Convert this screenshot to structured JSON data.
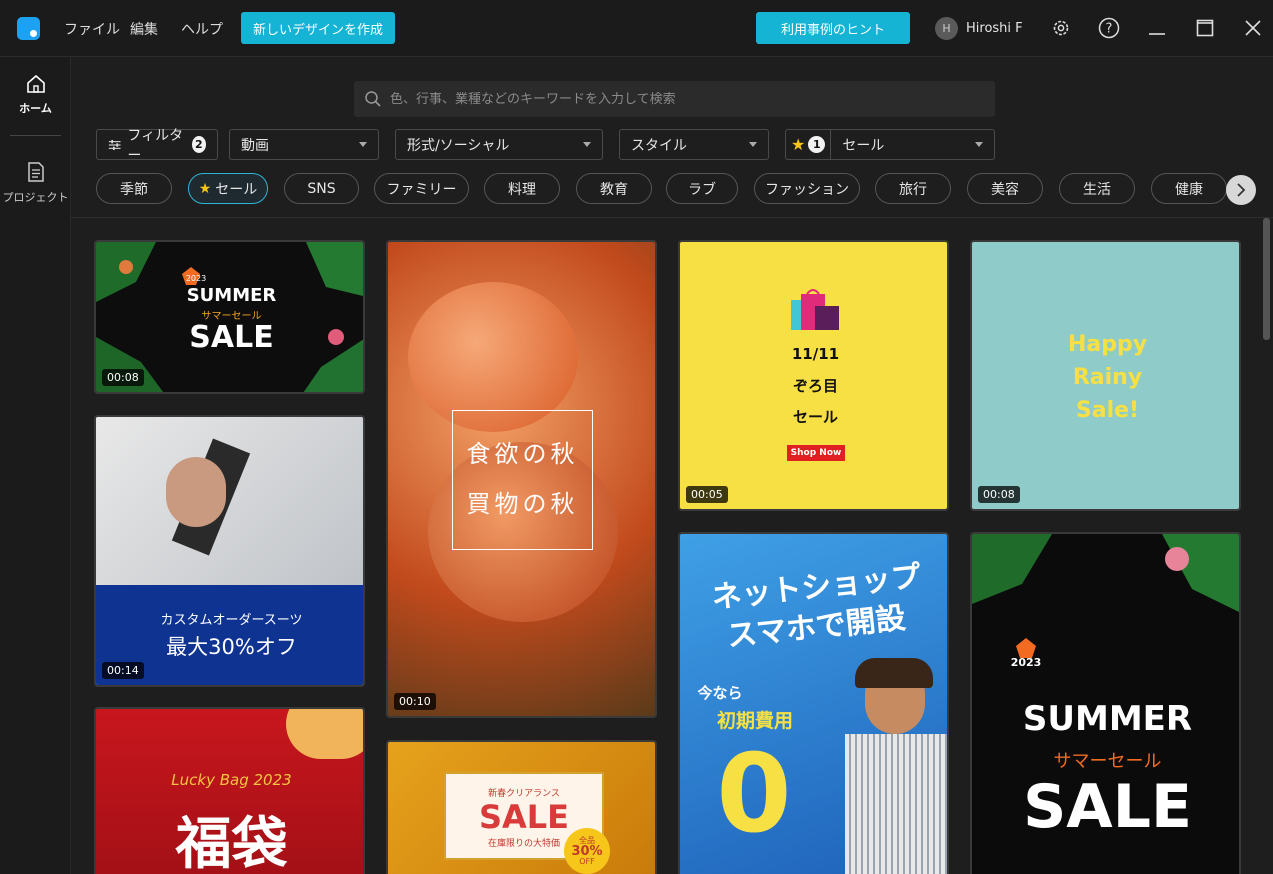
{
  "titlebar": {
    "menu": [
      "ファイル",
      "編集",
      "ヘルプ"
    ],
    "create_button": "新しいデザインを作成",
    "hint_button": "利用事例のヒント",
    "user_initial": "H",
    "user_name": "Hiroshi F"
  },
  "sidebar": {
    "home_label": "ホーム",
    "projects_label": "プロジェクト"
  },
  "search": {
    "placeholder": "色、行事、業種などのキーワードを入力して検索"
  },
  "filters": {
    "filter_label": "フィルター",
    "filter_count": "2",
    "type_value": "動画",
    "format_value": "形式/ソーシャル",
    "style_value": "スタイル",
    "fav_count": "1",
    "category_value": "セール"
  },
  "tags": [
    "季節",
    "セール",
    "SNS",
    "ファミリー",
    "料理",
    "教育",
    "ラブ",
    "ファッション",
    "旅行",
    "美容",
    "生活",
    "健康"
  ],
  "selected_tag": "セール",
  "cards": {
    "summer1": {
      "line1": "2023",
      "line2": "SUMMER",
      "line3": "サマーセール",
      "line4": "SALE",
      "duration": "00:08"
    },
    "suit": {
      "line1": "カスタムオーダースーツ",
      "line2": "最大30%オフ",
      "duration": "00:14"
    },
    "lucky": {
      "line1": "Lucky Bag 2023",
      "line2": "福袋"
    },
    "peach": {
      "line1": "食欲の秋",
      "line2": "買物の秋",
      "duration": "00:10"
    },
    "newyear": {
      "line1": "新春クリアランス",
      "line2": "SALE",
      "line3": "在庫限りの大特価",
      "badge1": "全品",
      "badge2": "30%",
      "badge3": "OFF"
    },
    "nov11": {
      "line1": "11/11",
      "line2": "ぞろ目",
      "line3": "セール",
      "shop": "Shop Now",
      "duration": "00:05"
    },
    "rainy": {
      "line1": "Happy",
      "line2": "Rainy",
      "line3": "Sale!",
      "duration": "00:08"
    },
    "netshop": {
      "line1": "ネットショップ",
      "line2": "スマホで開設",
      "line3": "今なら",
      "line4": "初期費用",
      "line5": "0"
    },
    "summer2": {
      "line1": "2023",
      "line2": "SUMMER",
      "line3": "サマーセール",
      "line4": "SALE"
    }
  },
  "colors": {
    "accent": "#15b4d4",
    "background": "#1e1e1e",
    "yellow_card": "#f7e043",
    "teal_card": "#8ecbc9"
  }
}
